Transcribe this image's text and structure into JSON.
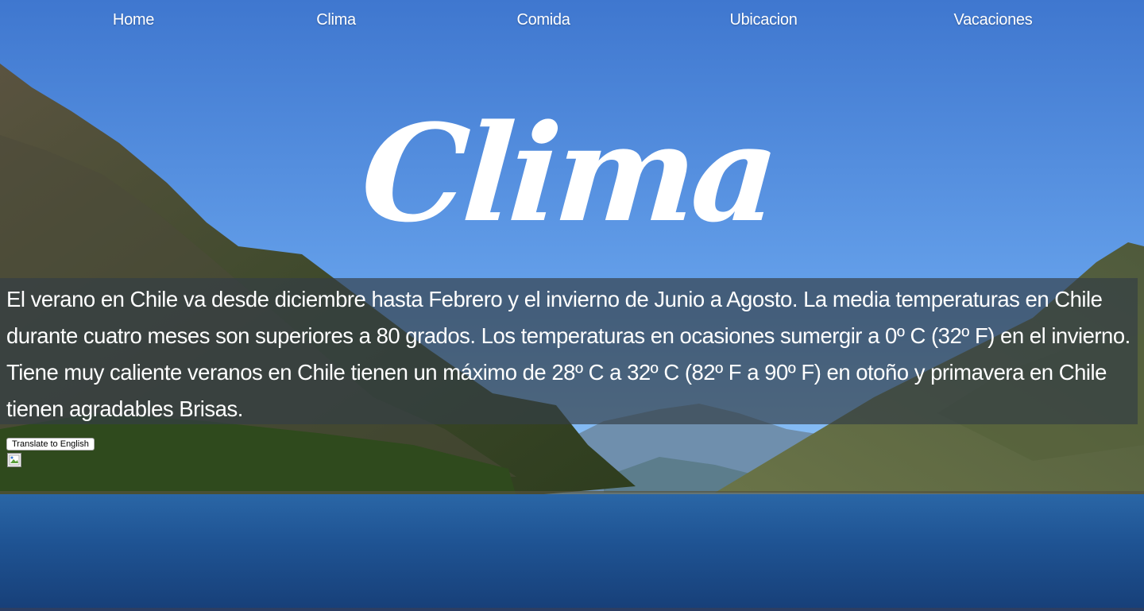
{
  "nav": {
    "items": [
      {
        "label": "Home"
      },
      {
        "label": "Clima"
      },
      {
        "label": "Comida"
      },
      {
        "label": "Ubicacion"
      },
      {
        "label": "Vacaciones"
      }
    ]
  },
  "hero": {
    "title": "Clima"
  },
  "content": {
    "paragraph": "El verano en Chile va desde diciembre hasta Febrero y el invierno de Junio a Agosto. La media temperaturas en Chile durante cuatro meses son superiores a 80 grados. Los temperaturas en ocasiones sumergir a 0º C (32º F) en el invierno. Tiene muy caliente veranos en Chile tienen un máximo de 28º C a 32º C (82º F a 90º F) en otoño y primavera en Chile tienen agradables Brisas."
  },
  "translate": {
    "button_label": "Translate to English"
  },
  "broken_image": {
    "icon": "broken-image-icon"
  },
  "colors": {
    "sky_top": "#3f77cf",
    "sky_bottom": "#7db6f5",
    "water": "#1f4f8c",
    "panel_overlay": "#343e46"
  }
}
